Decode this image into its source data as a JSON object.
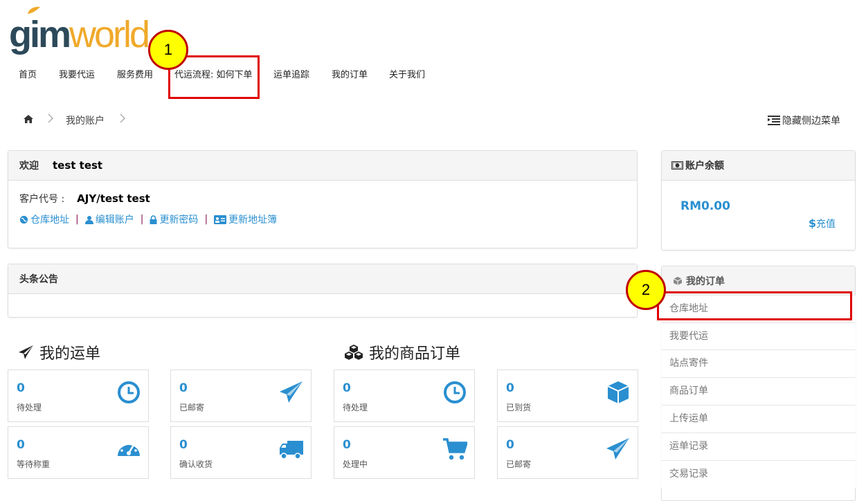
{
  "logo": {
    "part1": "gim",
    "part2": "world"
  },
  "nav": {
    "items": [
      "首页",
      "我要代运",
      "服务费用",
      "代运流程: 如何下单",
      "运单追踪",
      "我的订单",
      "关于我们"
    ]
  },
  "callouts": {
    "one": "1",
    "two": "2"
  },
  "breadcrumb": {
    "current": "我的账户"
  },
  "hide_menu": "隐藏侧边菜单",
  "welcome": {
    "label": "欢迎",
    "name": "test test",
    "code_label": "客户代号 :",
    "code_value": "AJY/test test",
    "links": [
      "仓库地址",
      "编辑账户",
      "更新密码",
      "更新地址簿"
    ]
  },
  "headline": {
    "title": "头条公告"
  },
  "shipments": {
    "title": "我的运单",
    "cards": [
      {
        "value": "0",
        "label": "待处理",
        "icon": "clock-icon"
      },
      {
        "value": "0",
        "label": "已邮寄",
        "icon": "paper-plane-icon"
      },
      {
        "value": "0",
        "label": "等待称重",
        "icon": "dashboard-icon"
      },
      {
        "value": "0",
        "label": "确认收货",
        "icon": "truck-icon"
      }
    ]
  },
  "products": {
    "title": "我的商品订单",
    "cards": [
      {
        "value": "0",
        "label": "待处理",
        "icon": "clock-icon"
      },
      {
        "value": "0",
        "label": "已到货",
        "icon": "cube-icon"
      },
      {
        "value": "0",
        "label": "处理中",
        "icon": "cart-icon"
      },
      {
        "value": "0",
        "label": "已邮寄",
        "icon": "paper-plane-icon"
      }
    ]
  },
  "balance": {
    "title": "账户余额",
    "amount": "RM0.00",
    "topup_symbol": "$",
    "topup": "充值"
  },
  "orders_menu": {
    "title": "我的订单",
    "items": [
      "仓库地址",
      "我要代运",
      "站点寄件",
      "商品订单",
      "上传运单",
      "运单记录",
      "交易记录"
    ]
  },
  "colors": {
    "accent": "#2a8fd0",
    "highlight": "#e00000",
    "callout": "#ffff00",
    "logo_dark": "#2d4a5a",
    "logo_orange": "#f0a92a"
  }
}
